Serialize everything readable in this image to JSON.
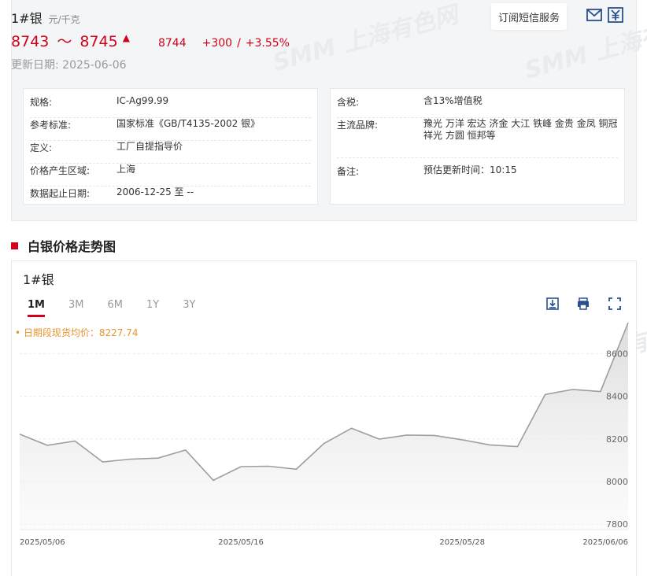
{
  "header": {
    "title": "1#银",
    "unit": "元/千克",
    "price_low": "8743",
    "tilde": "～",
    "price_high": "8745",
    "avg": "8744",
    "change": "+300",
    "slash": "/",
    "change_pct": "+3.55%",
    "update_label": "更新日期:",
    "update_date": "2025-06-06",
    "subscribe_label": "订阅短信服务"
  },
  "info_left": [
    {
      "k": "规格:",
      "v": "IC-Ag99.99"
    },
    {
      "k": "参考标准:",
      "v": "国家标准《GB/T4135-2002 银》"
    },
    {
      "k": "定义:",
      "v": "工厂自提指导价"
    },
    {
      "k": "价格产生区域:",
      "v": "上海"
    },
    {
      "k": "数据起止日期:",
      "v": "2006-12-25 至 --"
    }
  ],
  "info_right": [
    {
      "k": "含税:",
      "v": "含13%增值税"
    },
    {
      "k": "主流品牌:",
      "v": "豫光 万洋 宏达 济金 大江 铁峰 金贵 金凤 铜冠 祥光 方圆 恒邦等"
    },
    {
      "k": "备注:",
      "v": "预估更新时间：10:15"
    }
  ],
  "section_title": "白银价格走势图",
  "chart_title": "1#银",
  "range_tabs": [
    "1M",
    "3M",
    "6M",
    "1Y",
    "3Y"
  ],
  "active_tab": "1M",
  "legend_note": "• 日期段现货均价：8227.74",
  "watermark": "SMM 上海有色网",
  "icons": [
    "mail-icon",
    "yuan-icon",
    "download-icon",
    "print-icon",
    "fullscreen-icon"
  ],
  "colors": {
    "accent": "#d0021b",
    "line": "#9e9e9e",
    "note": "#e8952f"
  },
  "chart_data": {
    "type": "area",
    "title": "1#银",
    "x": [
      "2025/05/06",
      "2025/05/07",
      "2025/05/08",
      "2025/05/09",
      "2025/05/12",
      "2025/05/13",
      "2025/05/14",
      "2025/05/15",
      "2025/05/16",
      "2025/05/19",
      "2025/05/20",
      "2025/05/21",
      "2025/05/22",
      "2025/05/23",
      "2025/05/26",
      "2025/05/27",
      "2025/05/28",
      "2025/05/29",
      "2025/05/30",
      "2025/06/03",
      "2025/06/04",
      "2025/06/05",
      "2025/06/06"
    ],
    "values": [
      8222,
      8170,
      8190,
      8092,
      8105,
      8110,
      8148,
      8006,
      8070,
      8072,
      8058,
      8178,
      8250,
      8199,
      8218,
      8216,
      8196,
      8172,
      8164,
      8408,
      8432,
      8422,
      8744
    ],
    "x_tick_labels": [
      "2025/05/06",
      "2025/05/16",
      "2025/05/28",
      "2025/06/06"
    ],
    "y_ticks": [
      7800,
      8000,
      8200,
      8400,
      8600
    ],
    "ylim": [
      7775,
      8745
    ],
    "xlabel": "",
    "ylabel": "",
    "grid": true,
    "average": 8227.74
  }
}
